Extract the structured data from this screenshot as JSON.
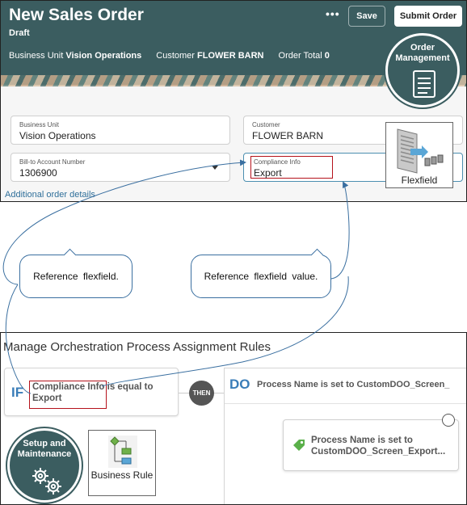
{
  "order": {
    "title": "New Sales Order",
    "status": "Draft",
    "business_unit_label": "Business Unit",
    "business_unit_value": "Vision Operations",
    "customer_label": "Customer",
    "customer_value": "FLOWER BARN",
    "order_total_label": "Order Total",
    "order_total_value": "0",
    "more_actions": "•••",
    "save_label": "Save",
    "submit_label": "Submit Order"
  },
  "form": {
    "business_unit": {
      "label": "Business Unit",
      "value": "Vision Operations"
    },
    "customer": {
      "label": "Customer",
      "value": "FLOWER BARN"
    },
    "bill_to": {
      "label": "Bill-to Account Number",
      "value": "1306900"
    },
    "compliance": {
      "label": "Compliance Info",
      "value": "Export"
    },
    "additional_details_link": "Additional order details"
  },
  "badges": {
    "order_management": "Order Management",
    "flexfield": "Flexfield",
    "setup_maintenance": "Setup and Maintenance",
    "business_rule": "Business Rule"
  },
  "callouts": {
    "left": "Reference flexfield.",
    "right": "Reference flexfield value."
  },
  "rules": {
    "title": "Manage Orchestration Process Assignment Rules",
    "if_tag": "IF",
    "condition_line1": "Compliance Info is equal to",
    "condition_line2": "Export",
    "then_label": "THEN",
    "do_tag": "DO",
    "do_text": "Process Name is set to CustomDOO_Screen_",
    "action_line1": "Process Name is set to",
    "action_line2": "CustomDOO_Screen_Export..."
  },
  "colors": {
    "header": "#3b5d60",
    "highlight": "#b5121b",
    "connector": "#3a6fa0",
    "link": "#2f6f9a"
  }
}
